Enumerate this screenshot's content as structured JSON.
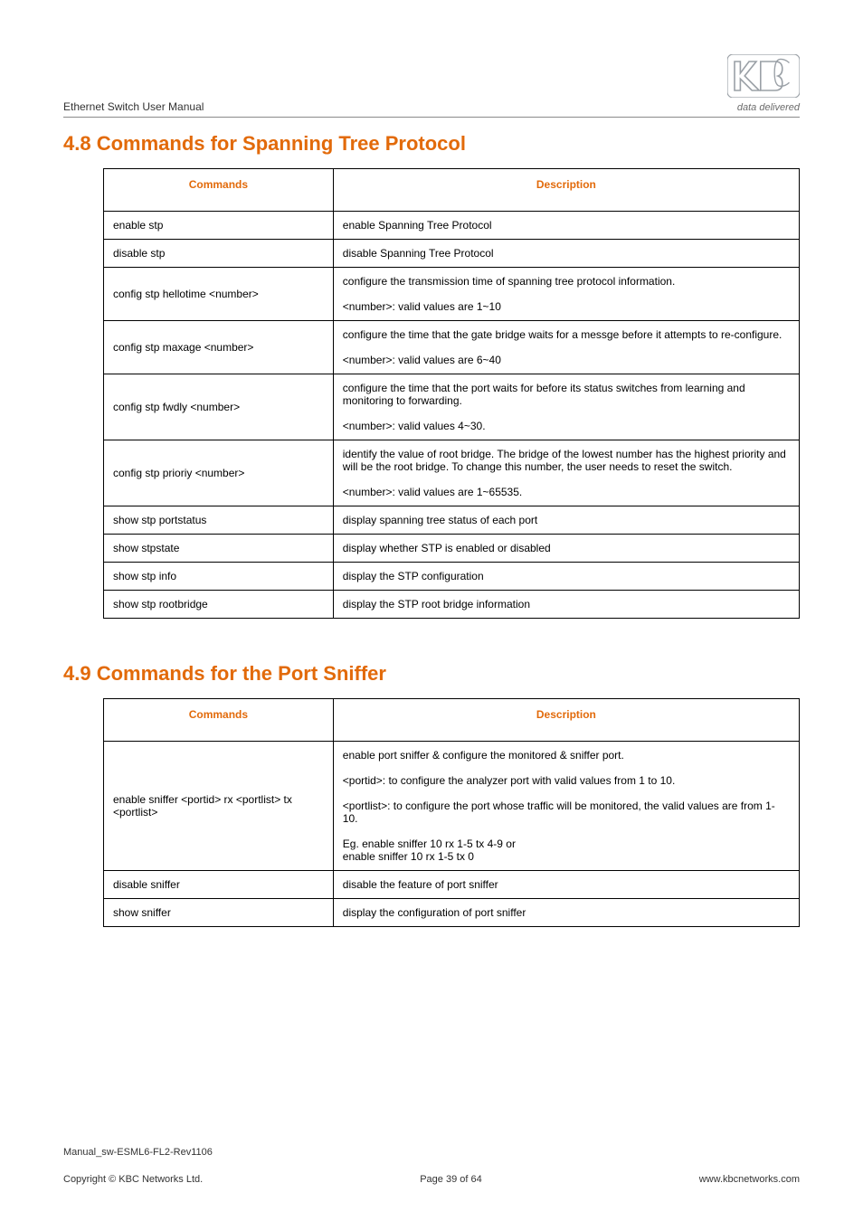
{
  "header": {
    "manual_title": "Ethernet Switch User Manual",
    "tagline": "data delivered"
  },
  "section48": {
    "title": "4.8 Commands for Spanning Tree Protocol",
    "head_cmd": "Commands",
    "head_desc": "Description",
    "rows": [
      {
        "cmd": "enable stp",
        "desc": [
          "enable Spanning Tree Protocol"
        ]
      },
      {
        "cmd": "disable stp",
        "desc": [
          "disable Spanning Tree Protocol"
        ]
      },
      {
        "cmd": "config stp hellotime <number>",
        "desc": [
          "configure the transmission time of spanning tree protocol information.",
          "<number>: valid values are 1~10"
        ]
      },
      {
        "cmd": "config stp maxage <number>",
        "desc": [
          "configure the time that the gate bridge waits for a messge before it attempts to re-configure.",
          "<number>: valid values are 6~40"
        ]
      },
      {
        "cmd": "config stp fwdly <number>",
        "desc": [
          "configure the time that the port waits for before its status switches from learning and monitoring to forwarding.",
          "<number>: valid values 4~30."
        ]
      },
      {
        "cmd": "config stp prioriy <number>",
        "desc": [
          " identify the value of root bridge. The bridge of the lowest number has the highest priority and will be the root bridge. To change this number, the user needs to reset the switch.",
          "<number>: valid values are 1~65535."
        ]
      },
      {
        "cmd": "show stp portstatus",
        "desc": [
          "display spanning tree status of each port"
        ]
      },
      {
        "cmd": "show stpstate",
        "desc": [
          "display whether STP is enabled or disabled"
        ]
      },
      {
        "cmd": "show stp info",
        "desc": [
          "display the STP configuration"
        ]
      },
      {
        "cmd": "show stp rootbridge",
        "desc": [
          "display the STP root bridge information"
        ]
      }
    ]
  },
  "section49": {
    "title": "4.9  Commands for the Port Sniffer",
    "head_cmd": "Commands",
    "head_desc": "Description",
    "rows": [
      {
        "cmd": "enable sniffer <portid> rx <portlist> tx <portlist>",
        "desc": [
          "enable port sniffer & configure the monitored & sniffer port.",
          "<portid>: to configure the analyzer port with valid values from 1 to 10.",
          "<portlist>: to configure the port whose traffic will be monitored, the valid values are from 1-10.",
          "Eg. enable sniffer 10 rx 1-5 tx 4-9 or\nenable sniffer 10 rx 1-5 tx 0"
        ]
      },
      {
        "cmd": "disable sniffer",
        "desc": [
          "disable the feature of port sniffer"
        ]
      },
      {
        "cmd": "show sniffer",
        "desc": [
          "display the configuration of port sniffer"
        ]
      }
    ]
  },
  "footer": {
    "manual_id": "Manual_sw-ESML6-FL2-Rev1106",
    "copyright": "Copyright © KBC Networks Ltd.",
    "page": "Page 39 of 64",
    "url": "www.kbcnetworks.com"
  }
}
